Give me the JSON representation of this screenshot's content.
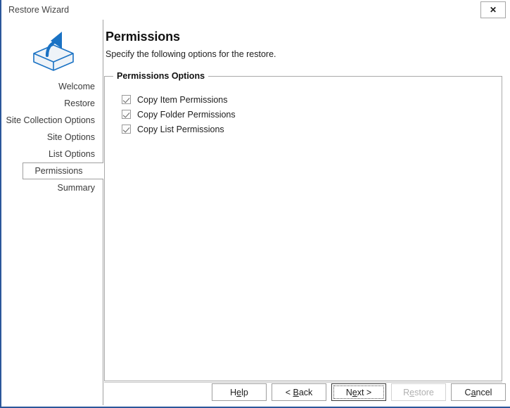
{
  "window": {
    "title": "Restore Wizard",
    "close_label": "✕",
    "accent_color": "#2b579a"
  },
  "sidebar": {
    "icon_name": "restore-box-arrow-icon",
    "steps": [
      {
        "label": "Welcome",
        "current": false
      },
      {
        "label": "Restore",
        "current": false
      },
      {
        "label": "Site Collection Options",
        "current": false
      },
      {
        "label": "Site Options",
        "current": false
      },
      {
        "label": "List Options",
        "current": false
      },
      {
        "label": "Permissions",
        "current": true
      },
      {
        "label": "Summary",
        "current": false
      }
    ]
  },
  "main": {
    "title": "Permissions",
    "subtitle": "Specify the following options for the restore.",
    "group": {
      "legend": "Permissions Options",
      "options": [
        {
          "label": "Copy Item Permissions",
          "checked": true
        },
        {
          "label": "Copy Folder Permissions",
          "checked": true
        },
        {
          "label": "Copy List Permissions",
          "checked": true
        }
      ]
    }
  },
  "footer": {
    "buttons": [
      {
        "name": "help-button",
        "pre": "H",
        "mnemonic": "e",
        "post": "lp",
        "default": false,
        "disabled": false
      },
      {
        "name": "back-button",
        "pre": "< ",
        "mnemonic": "B",
        "post": "ack",
        "default": false,
        "disabled": false
      },
      {
        "name": "next-button",
        "pre": "N",
        "mnemonic": "e",
        "post": "xt >",
        "default": true,
        "disabled": false
      },
      {
        "name": "restore-button",
        "pre": "R",
        "mnemonic": "e",
        "post": "store",
        "default": false,
        "disabled": true
      },
      {
        "name": "cancel-button",
        "pre": "C",
        "mnemonic": "a",
        "post": "ncel",
        "default": false,
        "disabled": false
      }
    ]
  }
}
